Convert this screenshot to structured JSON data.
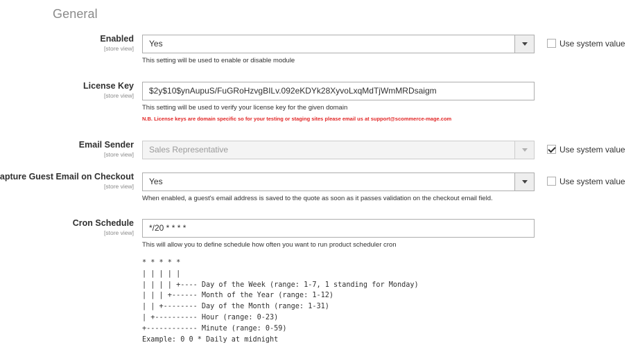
{
  "section": {
    "title": "General"
  },
  "fields": {
    "enabled": {
      "label": "Enabled",
      "scope": "[store view]",
      "value": "Yes",
      "note": "This setting will be used to enable or disable module",
      "use_system_value_label": "Use system value",
      "use_system_value_checked": false
    },
    "license_key": {
      "label": "License Key",
      "scope": "[store view]",
      "value": "$2y$10$ynAupuS/FuGRoHzvgBILv.092eKDYk28XyvoLxqMdTjWmMRDsaigm",
      "note": "This setting will be used to verify your license key for the given domain",
      "warning": "N.B. License keys are domain specific so for your testing or staging sites please email us at support@scommerce-mage.com"
    },
    "email_sender": {
      "label": "Email Sender",
      "scope": "[store view]",
      "value": "Sales Representative",
      "disabled": true,
      "use_system_value_label": "Use system value",
      "use_system_value_checked": true
    },
    "capture_guest_email": {
      "label": "Capture Guest Email on Checkout",
      "scope": "[store view]",
      "value": "Yes",
      "note": "When enabled, a guest's email address is saved to the quote as soon as it passes validation on the checkout email field.",
      "use_system_value_label": "Use system value",
      "use_system_value_checked": false
    },
    "cron_schedule": {
      "label": "Cron Schedule",
      "scope": "[store view]",
      "value": "*/20 * * * *",
      "note": "This will allow you to define schedule how often you want to run product scheduler cron",
      "help_lines": [
        "* * * * *",
        "| | | | |",
        "| | | | +---- Day of the Week (range: 1-7, 1 standing for Monday)",
        "| | | +------ Month of the Year (range: 1-12)",
        "| | +-------- Day of the Month (range: 1-31)",
        "| +---------- Hour (range: 0-23)",
        "+------------ Minute (range: 0-59)",
        "Example: 0 0 * Daily at midnight"
      ]
    }
  },
  "icons": {
    "select_arrow": "chevron-down-icon",
    "checkbox": "checkbox-icon"
  }
}
